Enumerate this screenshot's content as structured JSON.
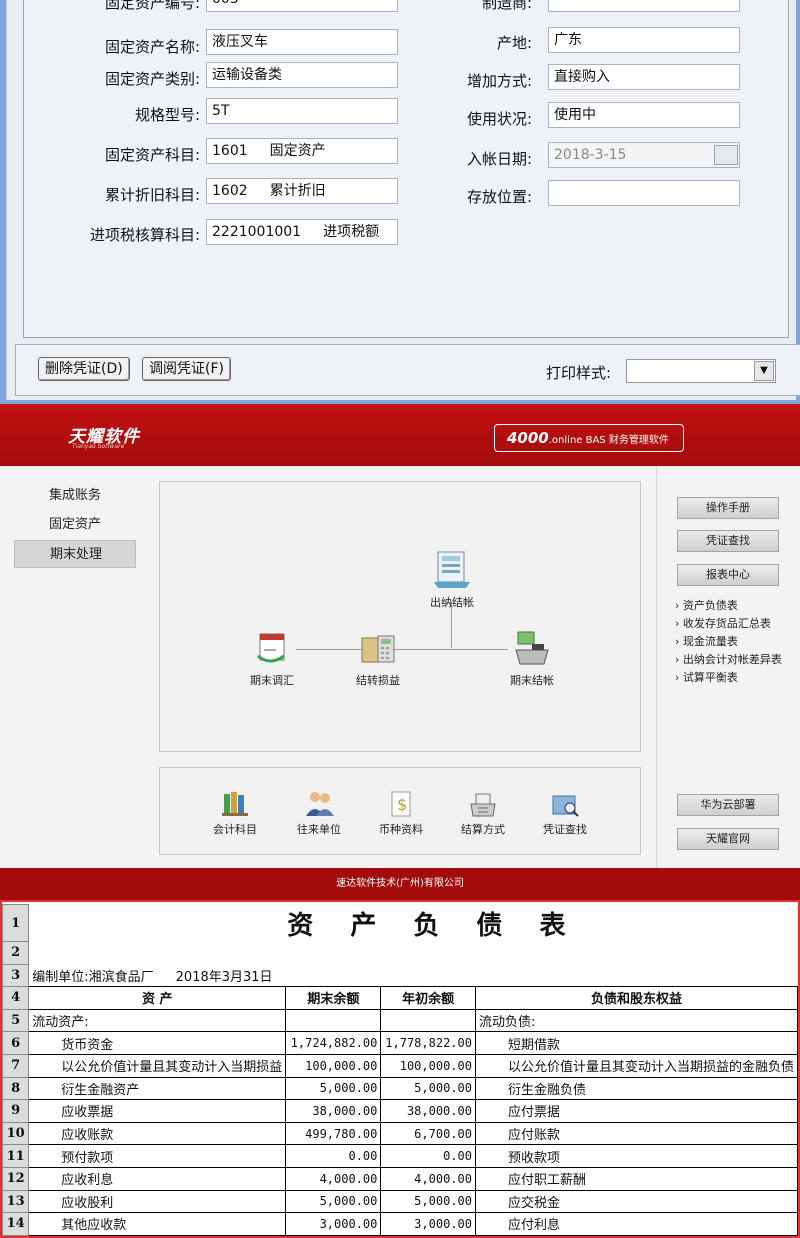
{
  "form": {
    "top_left_label": "固定资产编号:",
    "top_left_value": "003",
    "top_right_label": "制造商:",
    "rows": [
      {
        "label": "固定资产名称:",
        "value": "液压叉车",
        "rlabel": "产地:",
        "rvalue": "广东"
      },
      {
        "label": "固定资产类别:",
        "value": "运输设备类",
        "rlabel": "增加方式:",
        "rvalue": "直接购入"
      },
      {
        "label": "规格型号:",
        "value": "5T",
        "rlabel": "使用状况:",
        "rvalue": "使用中"
      },
      {
        "label": "固定资产科目:",
        "code": "1601",
        "name": "固定资产",
        "rlabel": "入帐日期:",
        "rvalue": "2018-3-15"
      },
      {
        "label": "累计折旧科目:",
        "code": "1602",
        "name": "累计折旧",
        "rlabel": "存放位置:",
        "rvalue": ""
      },
      {
        "label": "进项税核算科目:",
        "code": "2221001001",
        "name": "进项税额"
      }
    ],
    "delete_btn": "删除凭证(D)",
    "view_btn": "调阅凭证(F)",
    "print_label": "打印样式:"
  },
  "app": {
    "logo": "天耀软件",
    "logo_sub": "Tianyao Software",
    "badge_main": "4000",
    "badge_suffix": ".online BAS",
    "badge_text": "财务管理软件",
    "nav": [
      "集成账务",
      "固定资产",
      "期末处理"
    ],
    "flow": {
      "cashier_close": "出纳结帐",
      "period_adjust": "期末调汇",
      "carry_profit": "结转损益",
      "period_close": "期末结帐"
    },
    "tools": [
      "会计科目",
      "往来单位",
      "币种资料",
      "结算方式",
      "凭证查找"
    ],
    "right_buttons": [
      "操作手册",
      "凭证查找",
      "报表中心"
    ],
    "reports": [
      "资产负债表",
      "收发存货品汇总表",
      "现金流量表",
      "出纳会计对帐差异表",
      "试算平衡表"
    ],
    "cloud_buttons": [
      "华为云部署",
      "天耀官网"
    ],
    "footer": "速达软件技术(广州)有限公司"
  },
  "sheet": {
    "title": "资 产 负 债 表",
    "unit": "编制单位:湘滨食品厂",
    "date": "2018年3月31日",
    "header": [
      "资          产",
      "期末余额",
      "年初余额",
      "负债和股东权益"
    ],
    "rows": [
      {
        "n": "5",
        "a": "流动资产:",
        "b": "",
        "c": "",
        "d": "流动负债:",
        "sec": true
      },
      {
        "n": "6",
        "a": "货币资金",
        "b": "1,724,882.00",
        "c": "1,778,822.00",
        "d": "短期借款"
      },
      {
        "n": "7",
        "a": "以公允价值计量且其变动计入当期损益",
        "b": "100,000.00",
        "c": "100,000.00",
        "d": "以公允价值计量且其变动计入当期损益的金融负债"
      },
      {
        "n": "8",
        "a": "衍生金融资产",
        "b": "5,000.00",
        "c": "5,000.00",
        "d": "衍生金融负债"
      },
      {
        "n": "9",
        "a": "应收票据",
        "b": "38,000.00",
        "c": "38,000.00",
        "d": "应付票据"
      },
      {
        "n": "10",
        "a": "应收账款",
        "b": "499,780.00",
        "c": "6,700.00",
        "d": "应付账款"
      },
      {
        "n": "11",
        "a": "预付款项",
        "b": "0.00",
        "c": "0.00",
        "d": "预收款项"
      },
      {
        "n": "12",
        "a": "应收利息",
        "b": "4,000.00",
        "c": "4,000.00",
        "d": "应付职工薪酬"
      },
      {
        "n": "13",
        "a": "应收股利",
        "b": "5,000.00",
        "c": "5,000.00",
        "d": "应交税金"
      },
      {
        "n": "14",
        "a": "其他应收款",
        "b": "3,000.00",
        "c": "3,000.00",
        "d": "应付利息"
      }
    ]
  }
}
